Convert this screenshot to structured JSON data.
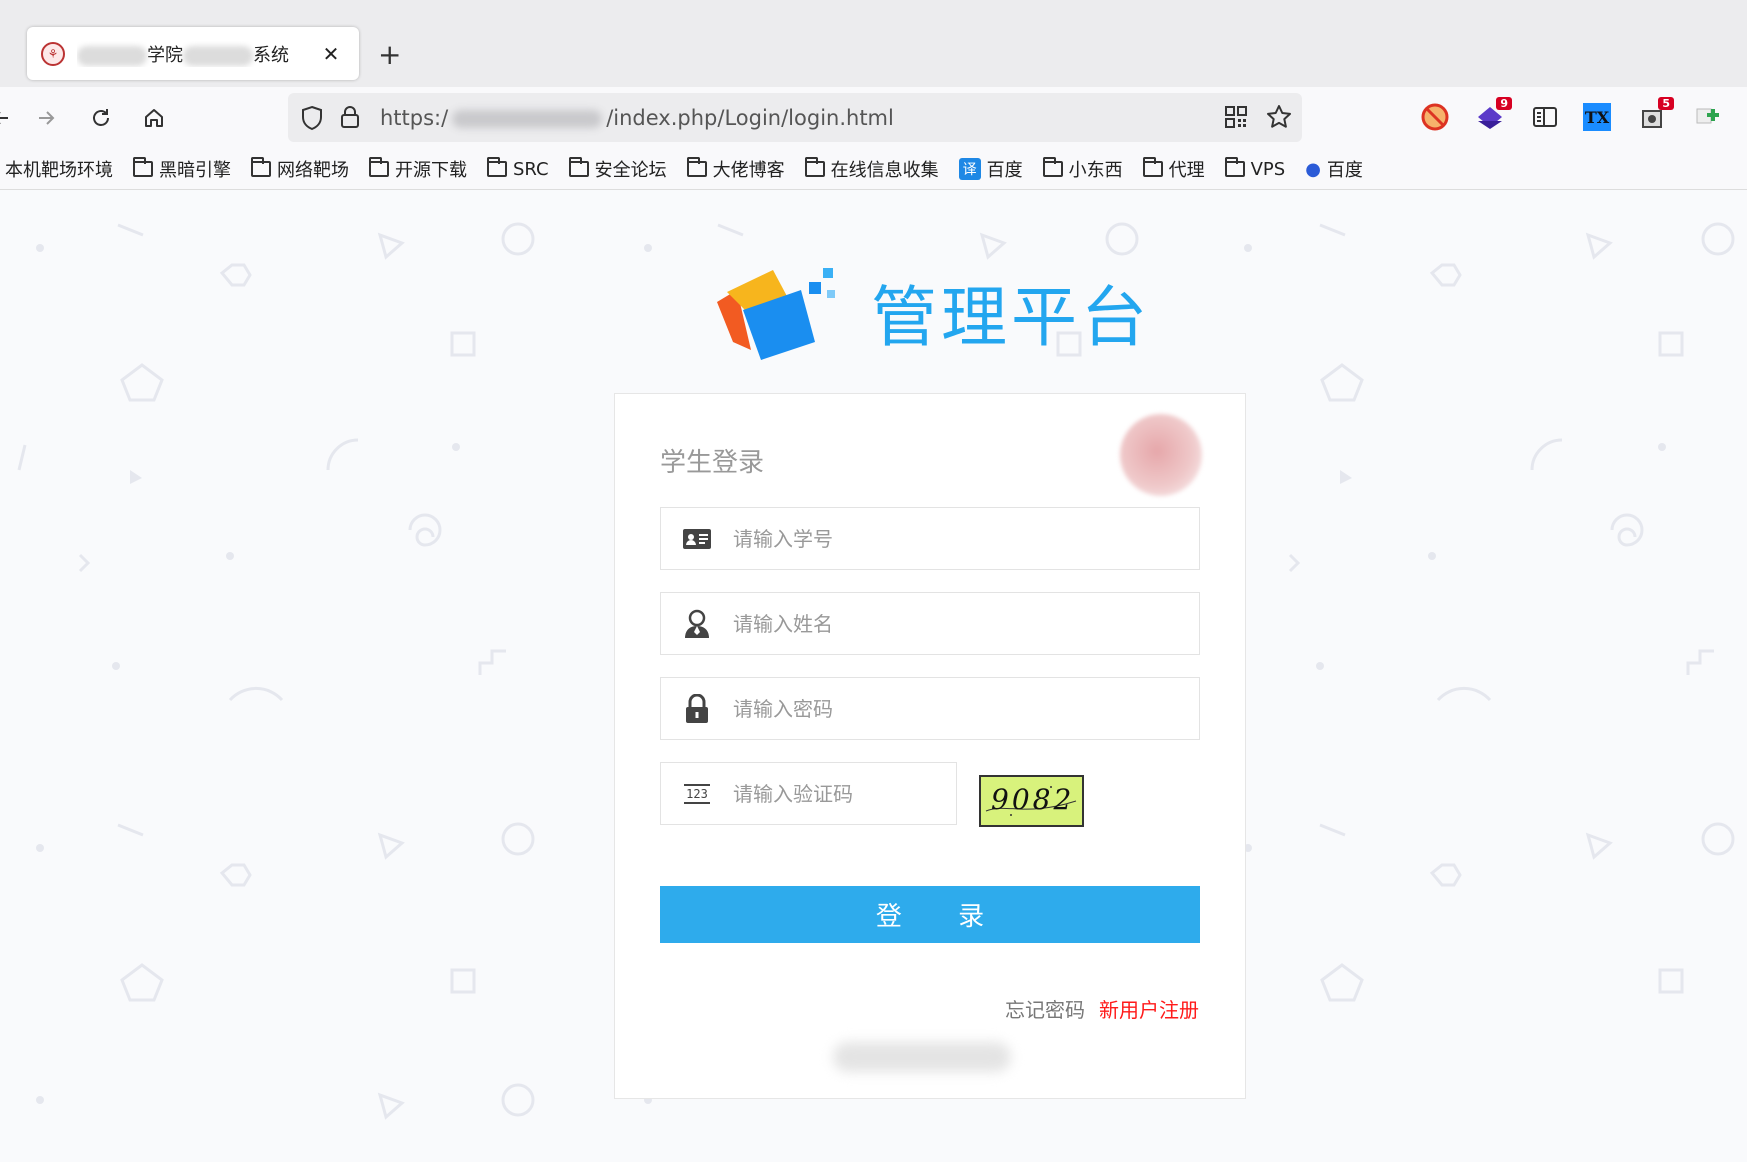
{
  "browser": {
    "tab": {
      "title_prefix": "",
      "title_mid": "学院",
      "title_suffix": "系统",
      "close": "✕"
    },
    "new_tab": "+",
    "url": {
      "prefix": "https:/",
      "suffix": "/index.php/Login/login.html"
    },
    "extensions": [
      {
        "name": "noscript-icon"
      },
      {
        "name": "extension-icon",
        "badge": "9"
      },
      {
        "name": "reader-view-icon"
      },
      {
        "name": "tx-icon",
        "label": "TX"
      },
      {
        "name": "screenshot-icon",
        "badge": "5"
      },
      {
        "name": "add-extension-icon"
      }
    ],
    "bookmarks": [
      {
        "label": "本机靶场环境",
        "type": "plain"
      },
      {
        "label": "黑暗引擎",
        "type": "folder"
      },
      {
        "label": "网络靶场",
        "type": "folder"
      },
      {
        "label": "开源下载",
        "type": "folder"
      },
      {
        "label": "SRC",
        "type": "folder"
      },
      {
        "label": "安全论坛",
        "type": "folder"
      },
      {
        "label": "大佬博客",
        "type": "folder"
      },
      {
        "label": "在线信息收集",
        "type": "folder"
      },
      {
        "label": "百度",
        "type": "translate",
        "icon_text": "译"
      },
      {
        "label": "小东西",
        "type": "folder"
      },
      {
        "label": "代理",
        "type": "folder"
      },
      {
        "label": "VPS",
        "type": "folder"
      },
      {
        "label": "百度",
        "type": "baidu",
        "icon_text": "🐾"
      }
    ]
  },
  "page": {
    "brand": "管理平台",
    "form": {
      "title": "学生登录",
      "student_id_placeholder": "请输入学号",
      "name_placeholder": "请输入姓名",
      "password_placeholder": "请输入密码",
      "captcha_placeholder": "请输入验证码",
      "captcha_icon_text": "123",
      "captcha_text": "9082",
      "login_button": "登 录",
      "forgot_password": "忘记密码",
      "register": "新用户注册"
    }
  },
  "colors": {
    "accent": "#2eabec",
    "brand": "#23a6ef",
    "register_link": "#ff1a1a",
    "captcha_bg": "#d8f27c"
  }
}
